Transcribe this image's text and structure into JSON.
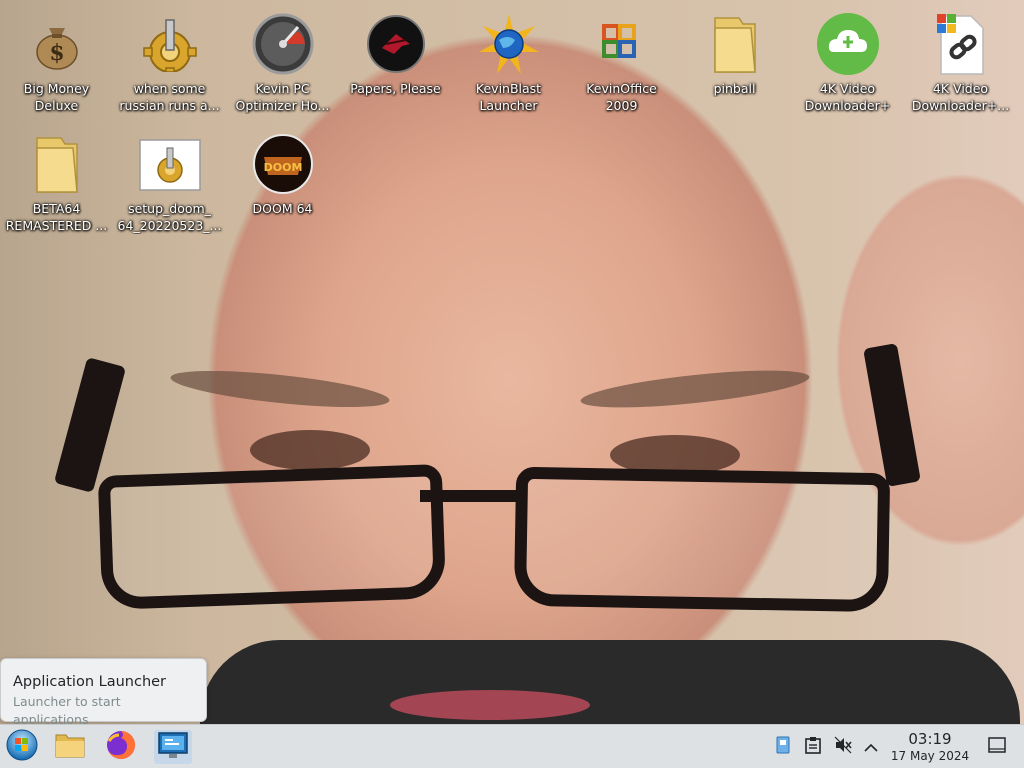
{
  "desktop": {
    "icons": [
      {
        "label": "Big Money\nDeluxe",
        "icon": "money-bag-icon"
      },
      {
        "label": "when some\nrussian runs a...",
        "icon": "gear-installer-icon"
      },
      {
        "label": "Kevin PC\nOptimizer Ho...",
        "icon": "gauge-icon"
      },
      {
        "label": "Papers, Please",
        "icon": "papers-please-icon"
      },
      {
        "label": "KevinBlast\nLauncher",
        "icon": "globe-star-icon"
      },
      {
        "label": "KevinOffice\n2009",
        "icon": "office-icon"
      },
      {
        "label": "pinball",
        "icon": "folder-icon"
      },
      {
        "label": "4K Video\nDownloader+",
        "icon": "cloud-download-icon"
      },
      {
        "label": "4K Video\nDownloader+...",
        "icon": "shortcut-link-icon"
      },
      {
        "label": "BETA64\nREMASTERED ...",
        "icon": "folder-icon"
      },
      {
        "label": "setup_doom_\n64_20220523_...",
        "icon": "setup-installer-icon"
      },
      {
        "label": "DOOM 64",
        "icon": "doom-icon"
      }
    ]
  },
  "tooltip": {
    "title": "Application Launcher",
    "subtitle": "Launcher to start applications"
  },
  "taskbar": {
    "pinned": [
      {
        "name": "application-launcher",
        "icon": "start-orb-icon"
      },
      {
        "name": "file-manager",
        "icon": "folder-icon"
      },
      {
        "name": "firefox",
        "icon": "firefox-icon"
      },
      {
        "name": "system-settings",
        "icon": "monitor-settings-icon"
      }
    ],
    "tray": [
      {
        "name": "network",
        "icon": "network-icon"
      },
      {
        "name": "clipboard",
        "icon": "clipboard-icon"
      },
      {
        "name": "volume-muted",
        "icon": "speaker-muted-icon"
      },
      {
        "name": "show-hidden",
        "icon": "chevron-up-icon"
      }
    ],
    "clock": {
      "time": "03:19",
      "date": "17 May 2024"
    }
  },
  "colors": {
    "taskbar_bg": "#dde1e4",
    "tooltip_bg": "#eff0f1",
    "icon_label": "#ffffff"
  }
}
